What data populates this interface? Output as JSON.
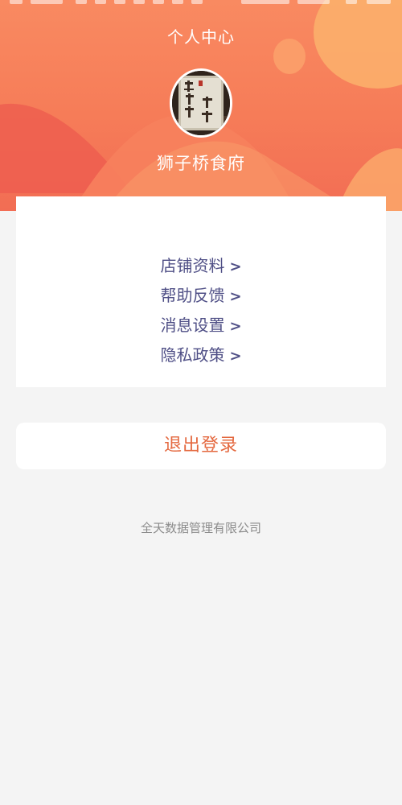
{
  "header": {
    "title": "个人中心",
    "store_name": "狮子桥食府",
    "avatar_icon": "storefront-sign-icon"
  },
  "menu": {
    "items": [
      {
        "label": "店铺资料",
        "chevron": ">"
      },
      {
        "label": "帮助反馈",
        "chevron": ">"
      },
      {
        "label": "消息设置",
        "chevron": ">"
      },
      {
        "label": "隐私政策",
        "chevron": ">"
      }
    ]
  },
  "logout": {
    "label": "退出登录"
  },
  "footer": {
    "company": "全天数据管理有限公司"
  },
  "colors": {
    "banner": "#f67c58",
    "menu_text": "#4f4f86",
    "logout_text": "#e4683f",
    "background": "#f4f4f4"
  }
}
